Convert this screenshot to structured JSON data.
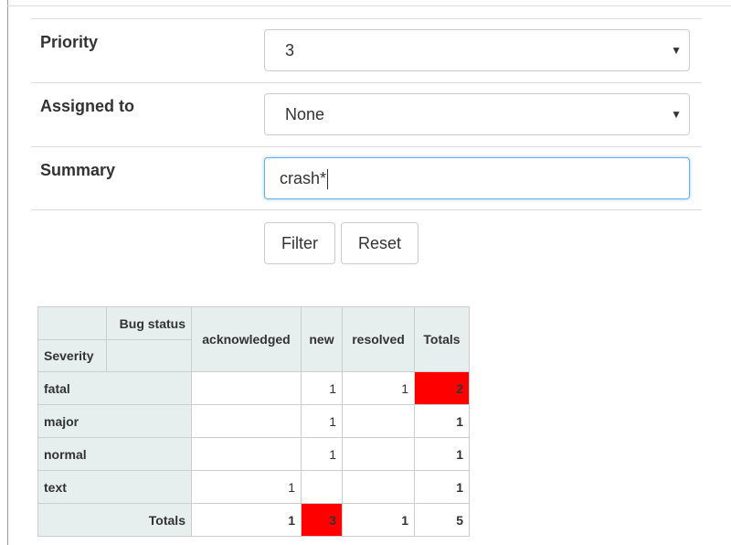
{
  "form": {
    "priority": {
      "label": "Priority",
      "value": "3"
    },
    "assigned": {
      "label": "Assigned to",
      "value": "None"
    },
    "summary": {
      "label": "Summary",
      "value": "crash*"
    },
    "filter_label": "Filter",
    "reset_label": "Reset",
    "caret": "▼"
  },
  "pivot": {
    "col_attr": "Bug status",
    "row_attr": "Severity",
    "columns": [
      "acknowledged",
      "new",
      "resolved"
    ],
    "totals_label": "Totals",
    "rows": [
      {
        "label": "fatal",
        "cells": [
          "",
          "1",
          "1"
        ],
        "total": "2"
      },
      {
        "label": "major",
        "cells": [
          "",
          "1",
          ""
        ],
        "total": "1"
      },
      {
        "label": "normal",
        "cells": [
          "",
          "1",
          ""
        ],
        "total": "1"
      },
      {
        "label": "text",
        "cells": [
          "1",
          "",
          ""
        ],
        "total": "1"
      }
    ],
    "col_totals": [
      "1",
      "3",
      "1"
    ],
    "grand_total": "5",
    "highlight_color": "#ff0000"
  }
}
